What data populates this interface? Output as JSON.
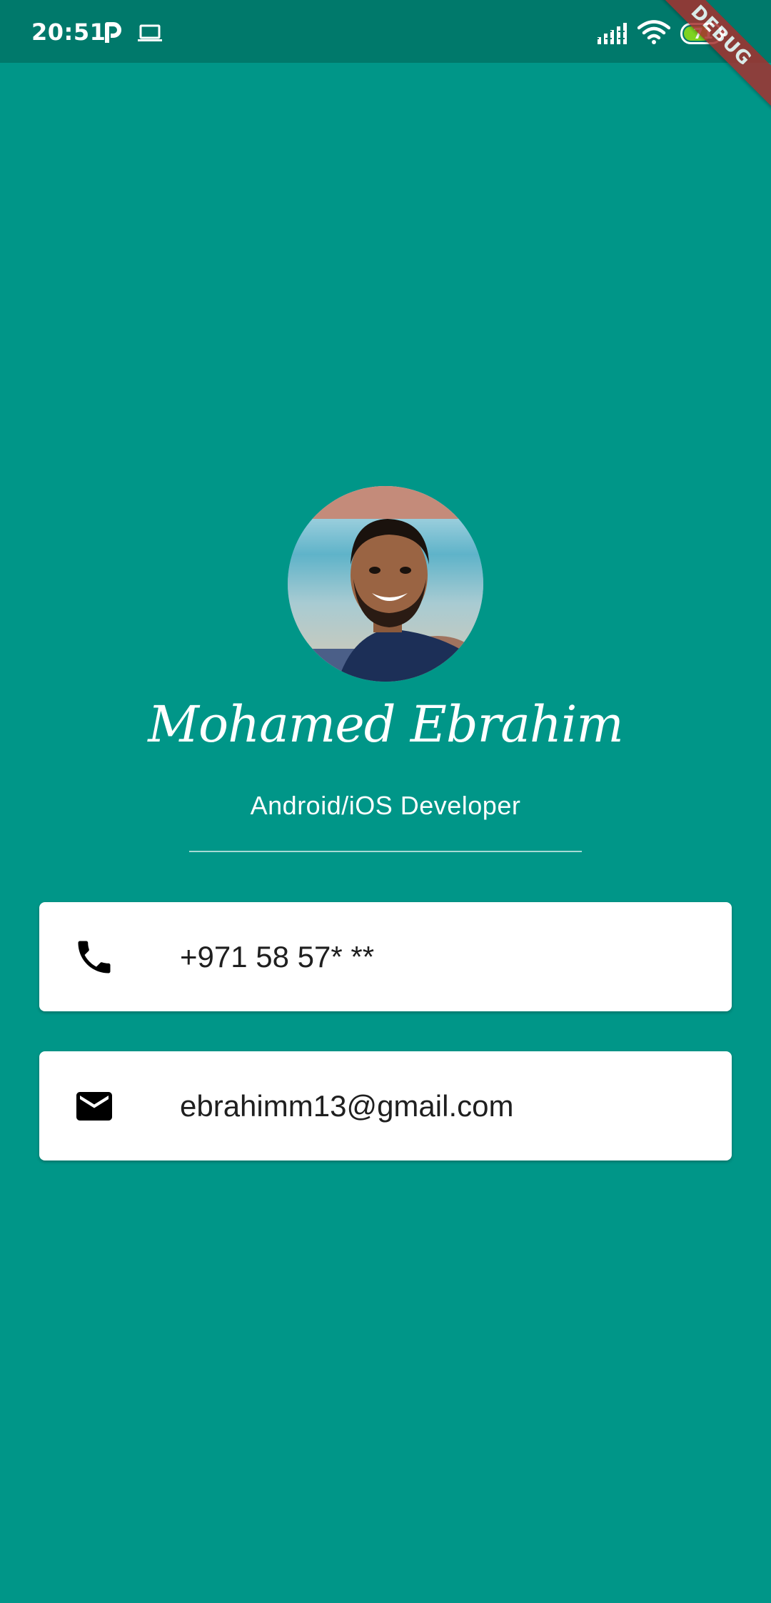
{
  "status_bar": {
    "time": "20:51",
    "battery_level": "71",
    "icons": [
      "parking-p-icon",
      "laptop-icon",
      "signal-icon",
      "wifi-icon",
      "battery-icon"
    ]
  },
  "debug_banner": {
    "label": "DEBUG"
  },
  "profile": {
    "avatar_alt": "profile-photo",
    "name": "Mohamed Ebrahim",
    "title": "Android/iOS Developer"
  },
  "contacts": {
    "phone": {
      "icon": "phone-icon",
      "value": "+971 58 57* **"
    },
    "email": {
      "icon": "mail-icon",
      "value": "ebrahimm13@gmail.com"
    }
  },
  "colors": {
    "background": "#009688",
    "status_bar": "#00796b",
    "card": "#ffffff",
    "debug_banner": "#a5312f"
  }
}
